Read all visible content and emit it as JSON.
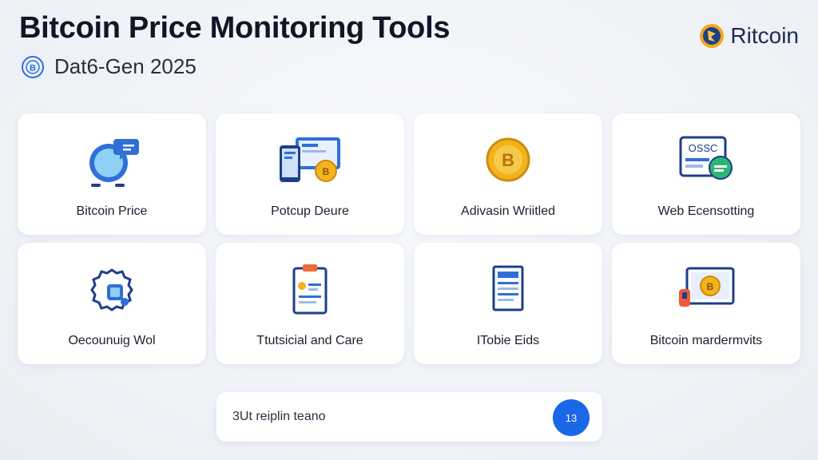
{
  "header": {
    "title": "Bitcoin Price Monitoring Tools",
    "subtitle": "Dat6-Gen 2025",
    "brand": "Ritcoin"
  },
  "tools": [
    {
      "label": "Bitcoin Price",
      "icon": "chat-monitor-icon"
    },
    {
      "label": "Potcup Deure",
      "icon": "desktop-mobile-coin-icon"
    },
    {
      "label": "Adivasin Wriitled",
      "icon": "gold-coin-icon"
    },
    {
      "label": "Web Ecensotting",
      "icon": "web-window-icon"
    },
    {
      "label": "Oecounuig Wol",
      "icon": "gear-chip-icon"
    },
    {
      "label": "Ttutsicial and Care",
      "icon": "clipboard-icon"
    },
    {
      "label": "ITobie Eids",
      "icon": "document-icon"
    },
    {
      "label": "Bitcoin mardermvits",
      "icon": "monitor-coin-icon"
    }
  ],
  "search": {
    "value": "3Ut reiplin teano",
    "button_label": "13"
  },
  "colors": {
    "accent": "#1a67e8",
    "coin": "#f2b41c",
    "icon_blue": "#2f6fd8"
  }
}
